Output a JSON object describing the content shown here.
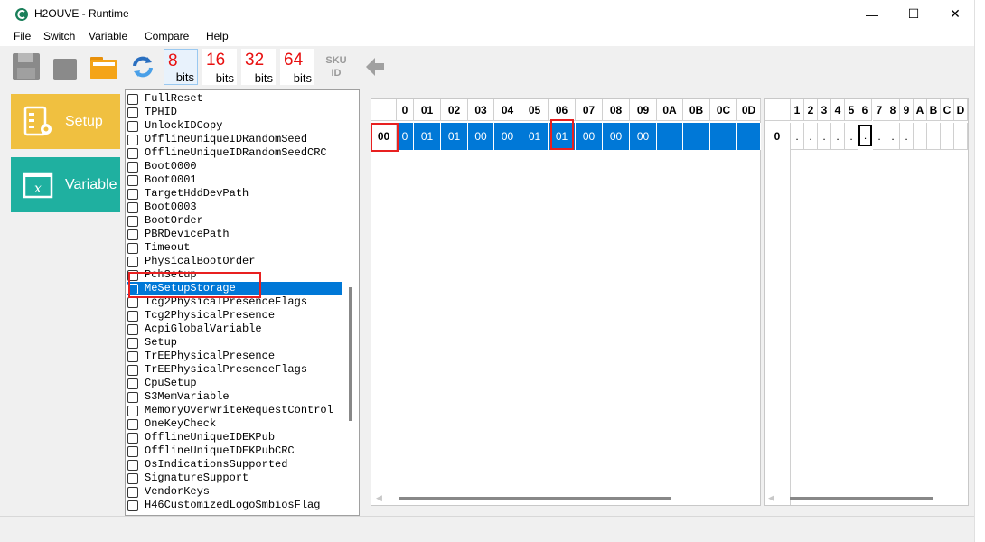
{
  "window": {
    "title": "H2OUVE - Runtime",
    "minimize": "—",
    "maximize": "☐",
    "close": "✕"
  },
  "menu": [
    "File",
    "Switch",
    "Variable",
    "Compare",
    "Help"
  ],
  "toolbar": {
    "icons": [
      "save-icon",
      "disk-icon",
      "open-folder-icon",
      "refresh-icon",
      "sku-id-icon",
      "back-arrow-icon"
    ],
    "bits": [
      {
        "num": "8",
        "label": "bits"
      },
      {
        "num": "16",
        "label": "bits"
      },
      {
        "num": "32",
        "label": "bits"
      },
      {
        "num": "64",
        "label": "bits"
      }
    ],
    "sku": [
      "SKU",
      "ID"
    ]
  },
  "sidebar": {
    "setup": {
      "label": "Setup",
      "color": "#f0c040"
    },
    "variable": {
      "label": "Variable",
      "color": "#1fb0a0"
    }
  },
  "variables": [
    "FullReset",
    "TPHID",
    "UnlockIDCopy",
    "OfflineUniqueIDRandomSeed",
    "OfflineUniqueIDRandomSeedCRC",
    "Boot0000",
    "Boot0001",
    "TargetHddDevPath",
    "Boot0003",
    "BootOrder",
    "PBRDevicePath",
    "Timeout",
    "PhysicalBootOrder",
    "PchSetup",
    "MeSetupStorage",
    "Tcg2PhysicalPresenceFlags",
    "Tcg2PhysicalPresence",
    "AcpiGlobalVariable",
    "Setup",
    "TrEEPhysicalPresence",
    "TrEEPhysicalPresenceFlags",
    "CpuSetup",
    "S3MemVariable",
    "MemoryOverwriteRequestControl",
    "OneKeyCheck",
    "OfflineUniqueIDEKPub",
    "OfflineUniqueIDEKPubCRC",
    "OsIndicationsSupported",
    "SignatureSupport",
    "VendorKeys",
    "H46CustomizedLogoSmbiosFlag"
  ],
  "selected_variable": "MeSetupStorage",
  "hex": {
    "columns": [
      "0",
      "01",
      "02",
      "03",
      "04",
      "05",
      "06",
      "07",
      "08",
      "09",
      "0A",
      "0B",
      "0C",
      "0D"
    ],
    "row_label": "00",
    "values": [
      "0",
      "01",
      "01",
      "00",
      "00",
      "01",
      "01",
      "00",
      "00",
      "00",
      "",
      "",
      "",
      ""
    ]
  },
  "ascii": {
    "row_label": "0",
    "columns": [
      "1",
      "2",
      "3",
      "4",
      "5",
      "6",
      "7",
      "8",
      "9",
      "A",
      "B",
      "C",
      "D"
    ],
    "values": [
      ".",
      ".",
      ".",
      ".",
      ".",
      ".",
      ".",
      ".",
      ".",
      "",
      "",
      "",
      ""
    ]
  },
  "colors": {
    "selection": "#0078d7",
    "highlight": "#e82020",
    "bits_red": "#e81010"
  }
}
